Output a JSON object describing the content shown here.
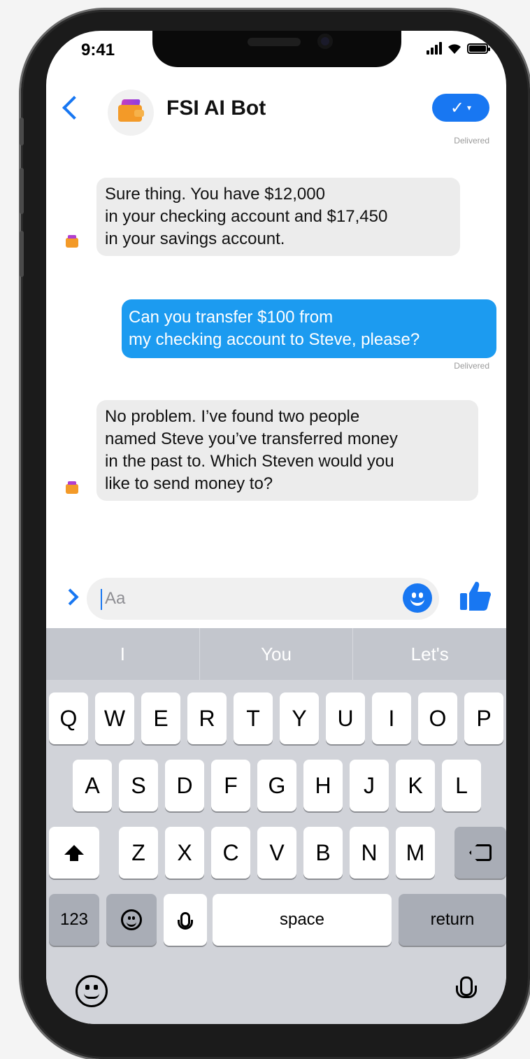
{
  "status_bar": {
    "time": "9:41"
  },
  "header": {
    "title": "FSI AI Bot",
    "check_symbol": "✓",
    "dropdown_symbol": "▾",
    "delivered": "Delivered"
  },
  "messages": [
    {
      "sender": "bot",
      "lines": [
        "Sure thing. You have $12,000",
        "in your checking account and $17,450",
        "in your savings account."
      ]
    },
    {
      "sender": "user",
      "lines": [
        "Can you transfer $100 from",
        "my checking account to Steve, please?"
      ],
      "status": "Delivered"
    },
    {
      "sender": "bot",
      "lines": [
        "No problem. I’ve found two people",
        "named Steve you’ve transferred money",
        "in the past to. Which Steven would you",
        "like to send money to?"
      ]
    }
  ],
  "composer": {
    "placeholder": "Aa"
  },
  "keyboard": {
    "suggestions": [
      "I",
      "You",
      "Let's"
    ],
    "row1": [
      "Q",
      "W",
      "E",
      "R",
      "T",
      "Y",
      "U",
      "I",
      "O",
      "P"
    ],
    "row2": [
      "A",
      "S",
      "D",
      "F",
      "G",
      "H",
      "J",
      "K",
      "L"
    ],
    "row3": [
      "Z",
      "X",
      "C",
      "V",
      "B",
      "N",
      "M"
    ],
    "numbers_label": "123",
    "space_label": "space",
    "return_label": "return"
  },
  "colors": {
    "accent": "#1877f2",
    "outgoing_bubble": "#1c9bf0",
    "incoming_bubble": "#ececec",
    "keyboard_bg": "#d1d3d9"
  }
}
